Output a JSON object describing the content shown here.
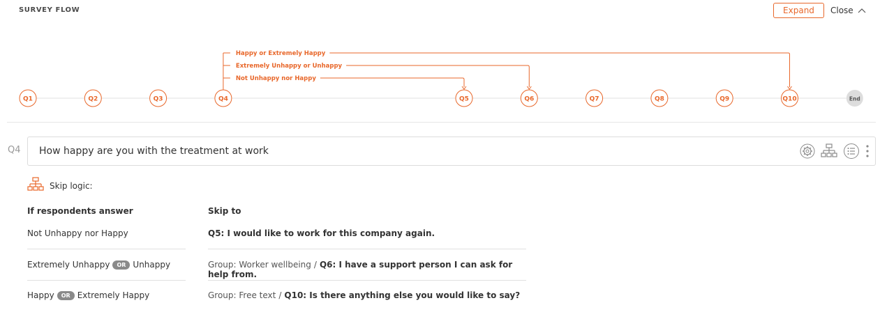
{
  "header": {
    "title": "SURVEY FLOW",
    "expand_label": "Expand",
    "close_label": "Close"
  },
  "flow": {
    "nodes": [
      "Q1",
      "Q2",
      "Q3",
      "Q4",
      "Q5",
      "Q6",
      "Q7",
      "Q8",
      "Q9",
      "Q10",
      "End"
    ],
    "branches": [
      {
        "label": "Happy or Extremely Happy",
        "from": "Q4",
        "to": "Q10"
      },
      {
        "label": "Extremely Unhappy or Unhappy",
        "from": "Q4",
        "to": "Q6"
      },
      {
        "label": "Not Unhappy nor Happy",
        "from": "Q4",
        "to": "Q5"
      }
    ],
    "accent_color": "#e8672a",
    "end_color": "#dddddd"
  },
  "question": {
    "number": "Q4",
    "text": "How happy are you with the treatment at work",
    "icons": [
      "settings-icon",
      "skip-logic-icon",
      "list-options-icon",
      "more-vertical-icon"
    ]
  },
  "skip_logic": {
    "label": "Skip logic:",
    "col_answer": "If respondents answer",
    "col_skip": "Skip to",
    "or_label": "OR",
    "rows": [
      {
        "answer_1": "Not Unhappy nor Happy",
        "answer_2": "",
        "group": "",
        "target": "Q5: I would like to work for this company again."
      },
      {
        "answer_1": "Extremely Unhappy",
        "answer_2": "Unhappy",
        "group": "Group: Worker wellbeing",
        "target": "Q6: I have a support person I can ask for help from."
      },
      {
        "answer_1": "Happy",
        "answer_2": "Extremely Happy",
        "group": "Group: Free text",
        "target": "Q10: Is there anything else you would like to say?"
      }
    ]
  }
}
